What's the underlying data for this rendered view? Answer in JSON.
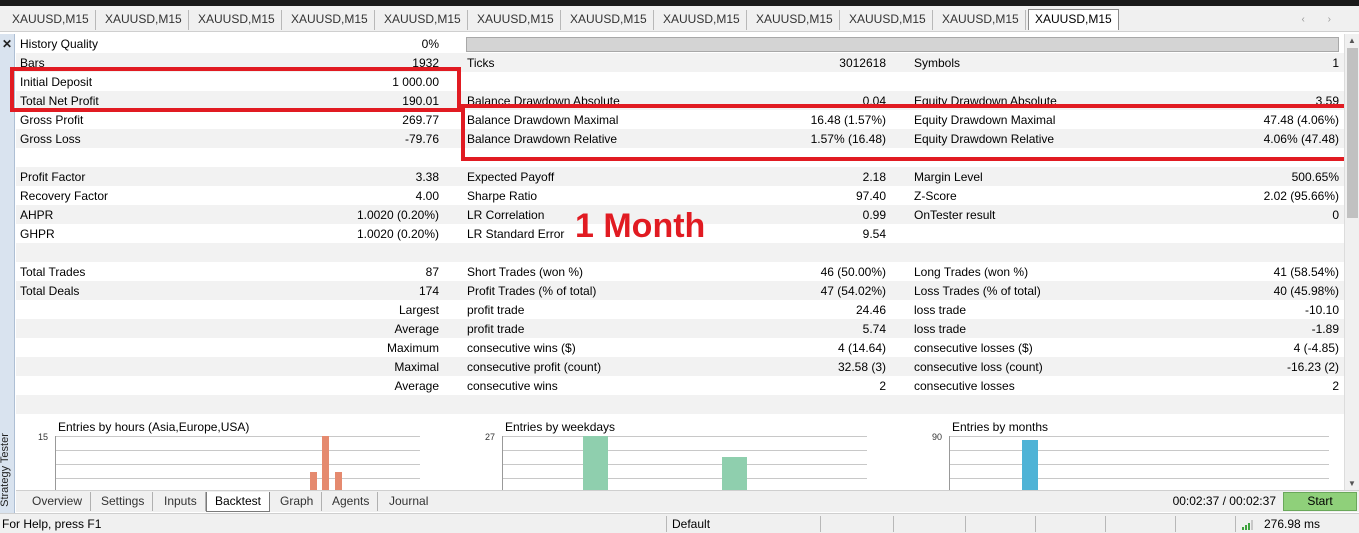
{
  "chart_tabs": [
    "XAUUSD,M15",
    "XAUUSD,M15",
    "XAUUSD,M15",
    "XAUUSD,M15",
    "XAUUSD,M15",
    "XAUUSD,M15",
    "XAUUSD,M15",
    "XAUUSD,M15",
    "XAUUSD,M15",
    "XAUUSD,M15",
    "XAUUSD,M15",
    "XAUUSD,M15"
  ],
  "side_title": "Strategy Tester",
  "report": {
    "r0": {
      "l1": "History Quality",
      "v1": "0%"
    },
    "r1": {
      "l1": "Bars",
      "v1": "1932",
      "l2": "Ticks",
      "v2": "3012618",
      "l3": "Symbols",
      "v3": "1"
    },
    "r2": {
      "l1": "Initial Deposit",
      "v1": "1 000.00"
    },
    "r3": {
      "l1": "Total Net Profit",
      "v1": "190.01",
      "l2": "Balance Drawdown Absolute",
      "v2": "0.04",
      "l3": "Equity Drawdown Absolute",
      "v3": "3.59"
    },
    "r4": {
      "l1": "Gross Profit",
      "v1": "269.77",
      "l2": "Balance Drawdown Maximal",
      "v2": "16.48 (1.57%)",
      "l3": "Equity Drawdown Maximal",
      "v3": "47.48 (4.06%)"
    },
    "r5": {
      "l1": "Gross Loss",
      "v1": "-79.76",
      "l2": "Balance Drawdown Relative",
      "v2": "1.57% (16.48)",
      "l3": "Equity Drawdown Relative",
      "v3": "4.06% (47.48)"
    },
    "r7": {
      "l1": "Profit Factor",
      "v1": "3.38",
      "l2": "Expected Payoff",
      "v2": "2.18",
      "l3": "Margin Level",
      "v3": "500.65%"
    },
    "r8": {
      "l1": "Recovery Factor",
      "v1": "4.00",
      "l2": "Sharpe Ratio",
      "v2": "97.40",
      "l3": "Z-Score",
      "v3": "2.02 (95.66%)"
    },
    "r9": {
      "l1": "AHPR",
      "v1": "1.0020 (0.20%)",
      "l2": "LR Correlation",
      "v2": "0.99",
      "l3": "OnTester result",
      "v3": "0"
    },
    "r10": {
      "l1": "GHPR",
      "v1": "1.0020 (0.20%)",
      "l2": "LR Standard Error",
      "v2": "9.54"
    },
    "r12": {
      "l1": "Total Trades",
      "v1": "87",
      "l2": "Short Trades (won %)",
      "v2": "46 (50.00%)",
      "l3": "Long Trades (won %)",
      "v3": "41 (58.54%)"
    },
    "r13": {
      "l1": "Total Deals",
      "v1": "174",
      "l2": "Profit Trades (% of total)",
      "v2": "47 (54.02%)",
      "l3": "Loss Trades (% of total)",
      "v3": "40 (45.98%)"
    },
    "r14": {
      "v1": "Largest",
      "l2": "profit trade",
      "v2": "24.46",
      "l3": "loss trade",
      "v3": "-10.10"
    },
    "r15": {
      "v1": "Average",
      "l2": "profit trade",
      "v2": "5.74",
      "l3": "loss trade",
      "v3": "-1.89"
    },
    "r16": {
      "v1": "Maximum",
      "l2": "consecutive wins ($)",
      "v2": "4 (14.64)",
      "l3": "consecutive losses ($)",
      "v3": "4 (-4.85)"
    },
    "r17": {
      "v1": "Maximal",
      "l2": "consecutive profit (count)",
      "v2": "32.58 (3)",
      "l3": "consecutive loss (count)",
      "v3": "-16.23 (2)"
    },
    "r18": {
      "v1": "Average",
      "l2": "consecutive wins",
      "v2": "2",
      "l3": "consecutive losses",
      "v3": "2"
    }
  },
  "annotation": {
    "text": "1 Month",
    "color": "#e11b22"
  },
  "mini_charts": [
    {
      "title": "Entries by hours (Asia,Europe,USA)",
      "ymax": "15",
      "color": "#e58a6f",
      "bars": [
        {
          "pos": 0.73,
          "frac": 1.0
        },
        {
          "pos": 0.695,
          "frac": 0.35
        },
        {
          "pos": 0.765,
          "frac": 0.35
        }
      ]
    },
    {
      "title": "Entries by weekdays",
      "ymax": "27",
      "color": "#8fcfae",
      "bars": [
        {
          "pos": 0.22,
          "frac": 1.0
        },
        {
          "pos": 0.6,
          "frac": 0.62
        }
      ]
    },
    {
      "title": "Entries by months",
      "ymax": "90",
      "color": "#4fb3d6",
      "bars": [
        {
          "pos": 0.19,
          "frac": 0.92
        }
      ]
    }
  ],
  "bottom_tabs": [
    "Overview",
    "Settings",
    "Inputs",
    "Backtest",
    "Graph",
    "Agents",
    "Journal"
  ],
  "active_bottom_tab": "Backtest",
  "timer": "00:02:37 / 00:02:37",
  "start_label": "Start",
  "status": {
    "help": "For Help, press F1",
    "profile": "Default",
    "ping": "276.98 ms"
  },
  "colors": {
    "start_button": "#8fd07a",
    "highlight": "#e11b22",
    "signal": "#3ea33e"
  }
}
